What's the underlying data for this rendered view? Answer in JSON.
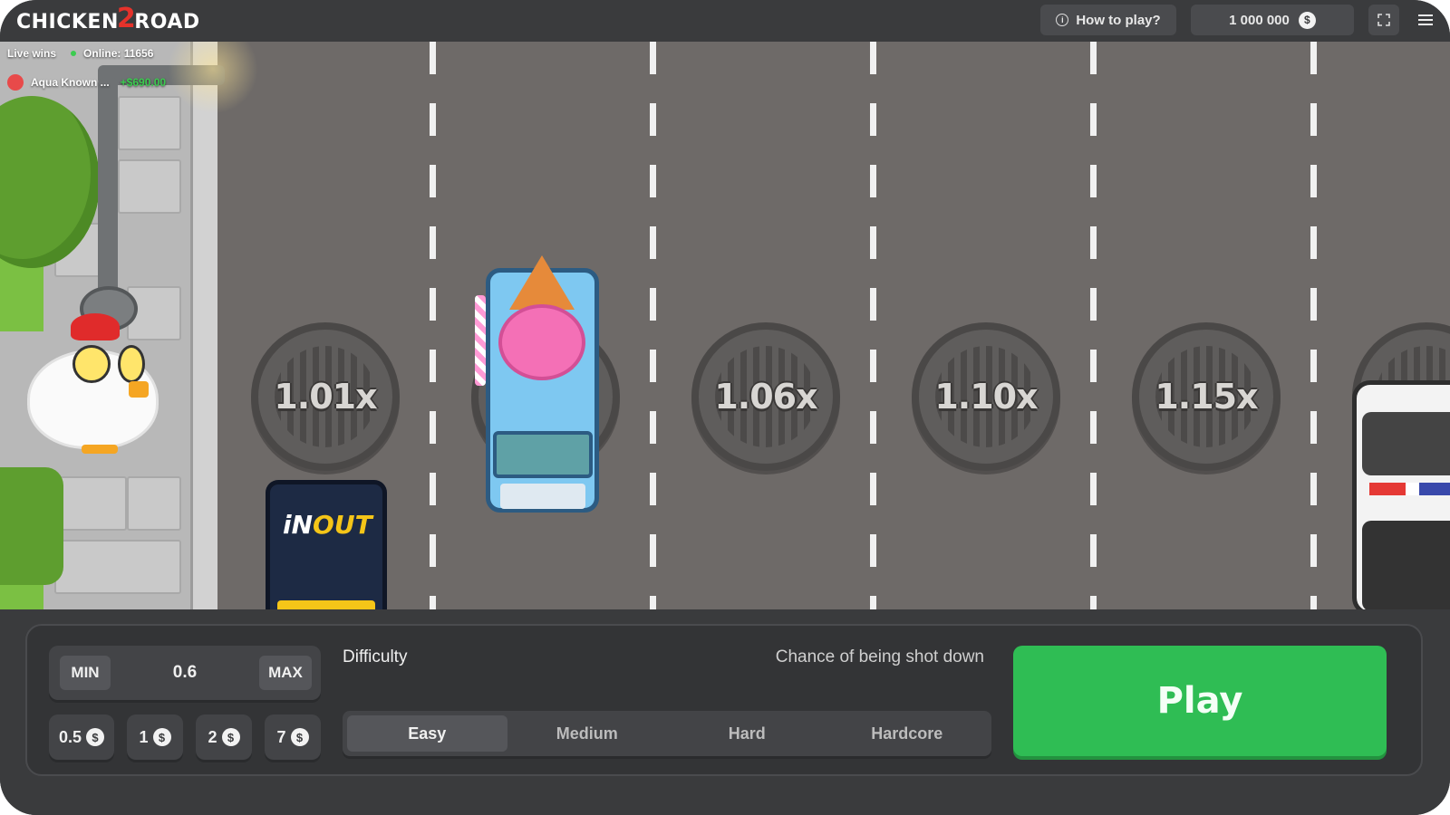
{
  "header": {
    "logo": {
      "part1": "CHICKEN",
      "number": "2",
      "part2": "ROAD"
    },
    "how_to_play": "How to play?",
    "balance": "1 000 000",
    "currency_symbol": "$",
    "icons": {
      "info": "info-circle-icon",
      "coin": "dollar-coin-icon",
      "fullscreen": "fullscreen-icon",
      "menu": "hamburger-menu-icon"
    }
  },
  "live": {
    "title": "Live wins",
    "online": "Online: 11656",
    "player": "Aqua Known ...",
    "amount": "+$690.00"
  },
  "lanes": {
    "multipliers": [
      "1.01x",
      "1.06x",
      "1.10x",
      "1.15x"
    ]
  },
  "vehicles": {
    "van_logo_a": "iN",
    "van_logo_b": "OUT"
  },
  "controls": {
    "min_label": "MIN",
    "max_label": "MAX",
    "bet_value": "0.6",
    "quick_bets": [
      "0.5",
      "1",
      "2",
      "7"
    ],
    "difficulty_label": "Difficulty",
    "chance_label": "Chance of being shot down",
    "difficulty_options": [
      "Easy",
      "Medium",
      "Hard",
      "Hardcore"
    ],
    "selected_difficulty": "Easy",
    "play_label": "Play"
  },
  "colors": {
    "play_green": "#2fbd54",
    "road": "#6e6a68",
    "panel": "#333436",
    "online_dot": "#3ccc50"
  }
}
